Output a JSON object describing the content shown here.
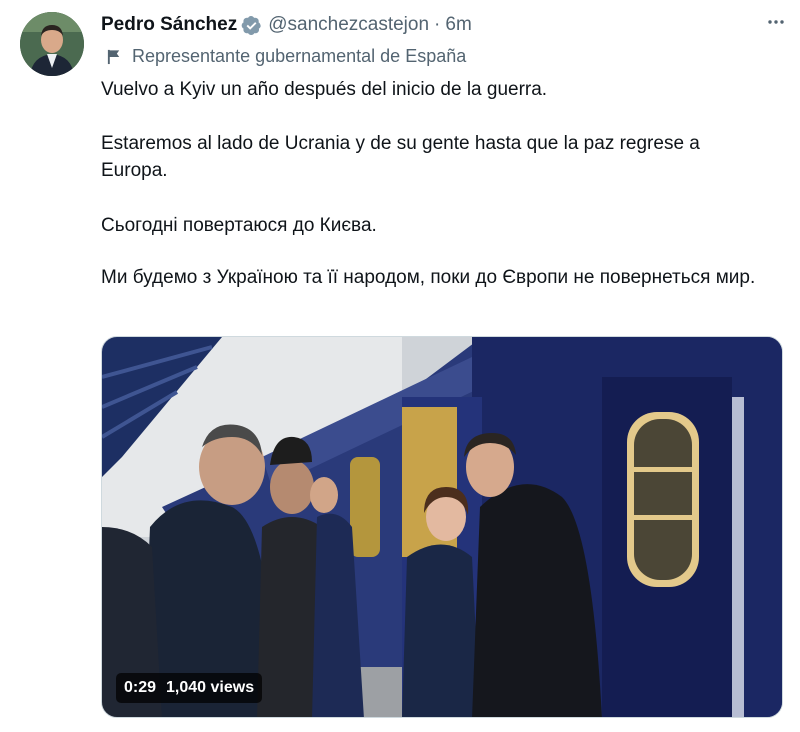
{
  "tweet": {
    "author_name": "Pedro Sánchez",
    "handle": "@sanchezcastejon",
    "separator": "·",
    "time": "6m",
    "affiliation_label": "Representante gubernamental de España",
    "text": {
      "p1": "Vuelvo a Kyiv un año después del inicio de la guerra.",
      "p2": "Estaremos al lado de Ucrania y de su gente hasta que la paz regrese a Europa.",
      "p3": "Сьогодні повертаюся до Києва.",
      "p4": "Ми будемо з Україною та її народом, поки до Європи не повернеться мир."
    }
  },
  "video": {
    "duration": "0:29",
    "views": "1,040 views"
  },
  "icons": {
    "verified": "verified-badge-icon",
    "more": "more-horizontal-icon",
    "affiliation": "flag-icon"
  },
  "colors": {
    "text": "#0f1419",
    "secondary": "#536471",
    "verified_gray": "#829aab"
  }
}
